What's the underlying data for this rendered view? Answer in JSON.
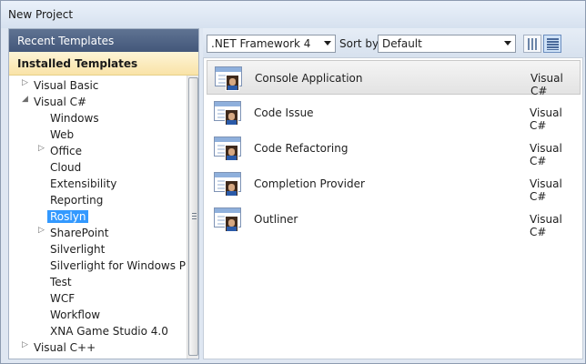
{
  "window": {
    "title": "New Project"
  },
  "left_panel": {
    "recent_label": "Recent Templates",
    "installed_label": "Installed Templates",
    "tree": [
      {
        "label": "Visual Basic",
        "level": 0,
        "expander": "collapsed"
      },
      {
        "label": "Visual C#",
        "level": 0,
        "expander": "expanded"
      },
      {
        "label": "Windows",
        "level": 1,
        "expander": "none"
      },
      {
        "label": "Web",
        "level": 1,
        "expander": "none"
      },
      {
        "label": "Office",
        "level": 1,
        "expander": "collapsed"
      },
      {
        "label": "Cloud",
        "level": 1,
        "expander": "none"
      },
      {
        "label": "Extensibility",
        "level": 1,
        "expander": "none"
      },
      {
        "label": "Reporting",
        "level": 1,
        "expander": "none"
      },
      {
        "label": "Roslyn",
        "level": 1,
        "expander": "none",
        "selected": true
      },
      {
        "label": "SharePoint",
        "level": 1,
        "expander": "collapsed"
      },
      {
        "label": "Silverlight",
        "level": 1,
        "expander": "none"
      },
      {
        "label": "Silverlight for Windows Phone",
        "level": 1,
        "expander": "none"
      },
      {
        "label": "Test",
        "level": 1,
        "expander": "none"
      },
      {
        "label": "WCF",
        "level": 1,
        "expander": "none"
      },
      {
        "label": "Workflow",
        "level": 1,
        "expander": "none"
      },
      {
        "label": "XNA Game Studio 4.0",
        "level": 1,
        "expander": "none"
      },
      {
        "label": "Visual C++",
        "level": 0,
        "expander": "collapsed"
      }
    ]
  },
  "toolbar": {
    "framework_value": ".NET Framework 4",
    "sortby_label": "Sort by:",
    "sort_value": "Default",
    "view_icons": [
      "medium-icons-view-icon",
      "small-icons-view-icon"
    ]
  },
  "templates": [
    {
      "name": "Console Application",
      "language": "Visual C#",
      "selected": true
    },
    {
      "name": "Code Issue",
      "language": "Visual C#"
    },
    {
      "name": "Code Refactoring",
      "language": "Visual C#"
    },
    {
      "name": "Completion Provider",
      "language": "Visual C#"
    },
    {
      "name": "Outliner",
      "language": "Visual C#"
    }
  ]
}
